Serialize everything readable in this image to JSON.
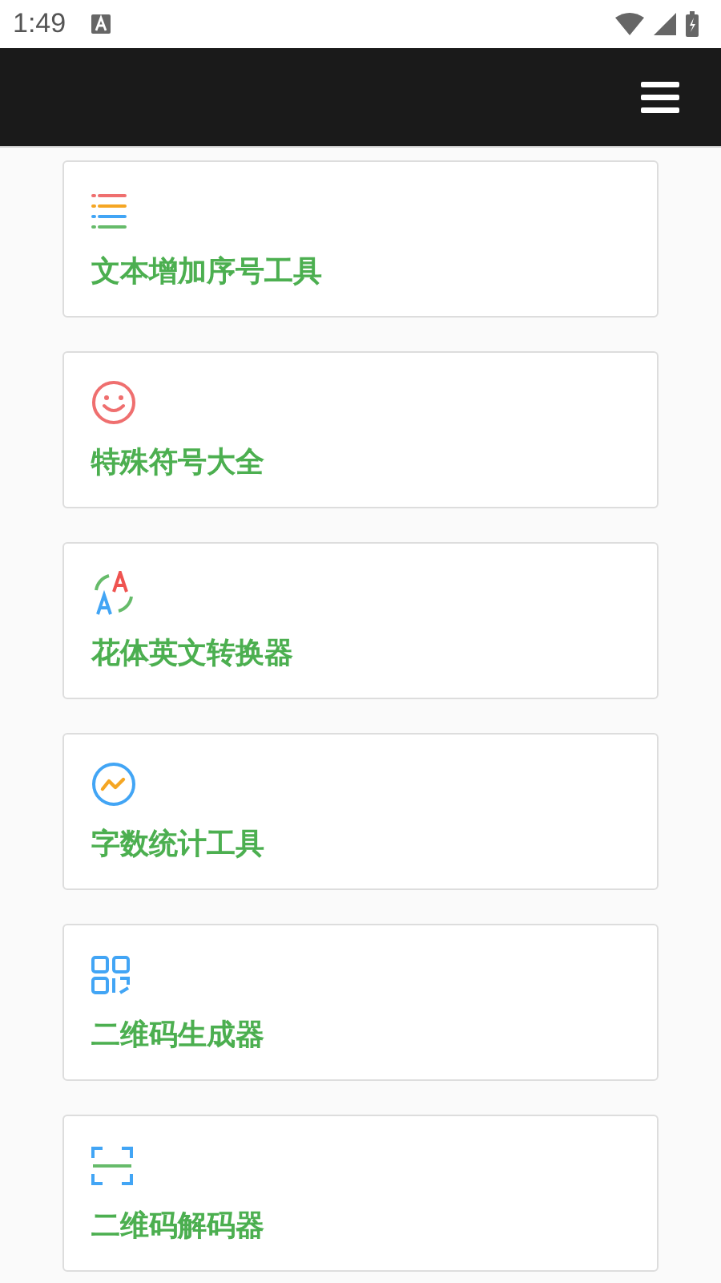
{
  "status_bar": {
    "time": "1:49"
  },
  "tools": [
    {
      "kind": "list",
      "label": "文本增加序号工具"
    },
    {
      "kind": "smile",
      "label": "特殊符号大全"
    },
    {
      "kind": "translate",
      "label": "花体英文转换器"
    },
    {
      "kind": "chart",
      "label": "字数统计工具"
    },
    {
      "kind": "qr",
      "label": "二维码生成器"
    },
    {
      "kind": "scan",
      "label": "二维码解码器"
    }
  ]
}
